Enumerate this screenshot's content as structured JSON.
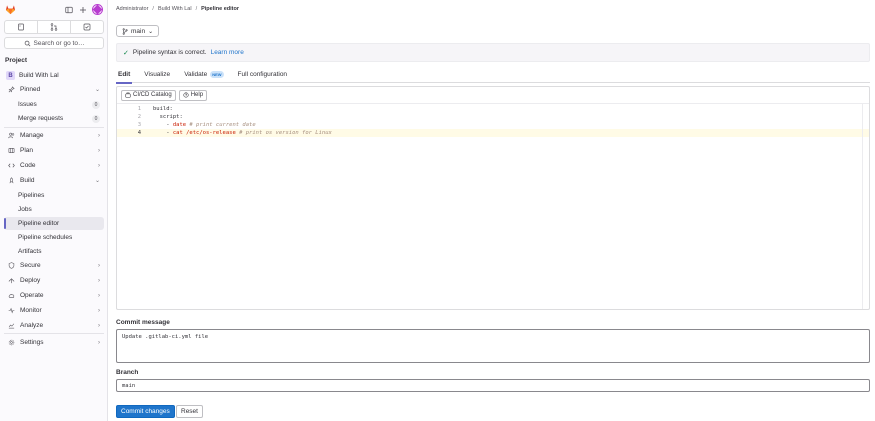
{
  "sidebar": {
    "search_label": "Search or go to…",
    "section_title": "Project",
    "project_name": "Build With Lal",
    "project_initial": "B",
    "items": {
      "pinned": "Pinned",
      "issues": "Issues",
      "issues_count": "0",
      "merge_requests": "Merge requests",
      "merge_requests_count": "0",
      "manage": "Manage",
      "plan": "Plan",
      "code": "Code",
      "build": "Build",
      "pipelines": "Pipelines",
      "jobs": "Jobs",
      "pipeline_editor": "Pipeline editor",
      "pipeline_schedules": "Pipeline schedules",
      "artifacts": "Artifacts",
      "secure": "Secure",
      "deploy": "Deploy",
      "operate": "Operate",
      "monitor": "Monitor",
      "analyze": "Analyze",
      "settings": "Settings"
    }
  },
  "breadcrumb": {
    "items": [
      "Administrator",
      "Build With Lal"
    ],
    "current": "Pipeline editor",
    "separator": "/"
  },
  "branch_selector": {
    "value": "main"
  },
  "alert": {
    "text": "Pipeline syntax is correct.",
    "link": "Learn more"
  },
  "tabs": {
    "edit": "Edit",
    "visualize": "Visualize",
    "validate": "Validate",
    "validate_badge": "NEW",
    "full_configuration": "Full configuration"
  },
  "editor_toolbar": {
    "catalog": "CI/CD Catalog",
    "help": "Help"
  },
  "code": {
    "line_numbers": [
      "1",
      "2",
      "3",
      "4"
    ],
    "line1": "build:",
    "line2": "  script:",
    "line3_indent": "    - ",
    "line3_cmd": "date",
    "line3_comment": " # print current date",
    "line4_indent": "    - ",
    "line4_cmd": "cat /etc/os-release",
    "line4_comment": " # print os version for Linux"
  },
  "commit": {
    "message_label": "Commit message",
    "message_value": "Update .gitlab-ci.yml file",
    "branch_label": "Branch",
    "branch_value": "main",
    "commit_button": "Commit changes",
    "reset_button": "Reset"
  },
  "colors": {
    "accent": "#6666c4",
    "primary_button": "#1f75cb",
    "success": "#108548"
  }
}
